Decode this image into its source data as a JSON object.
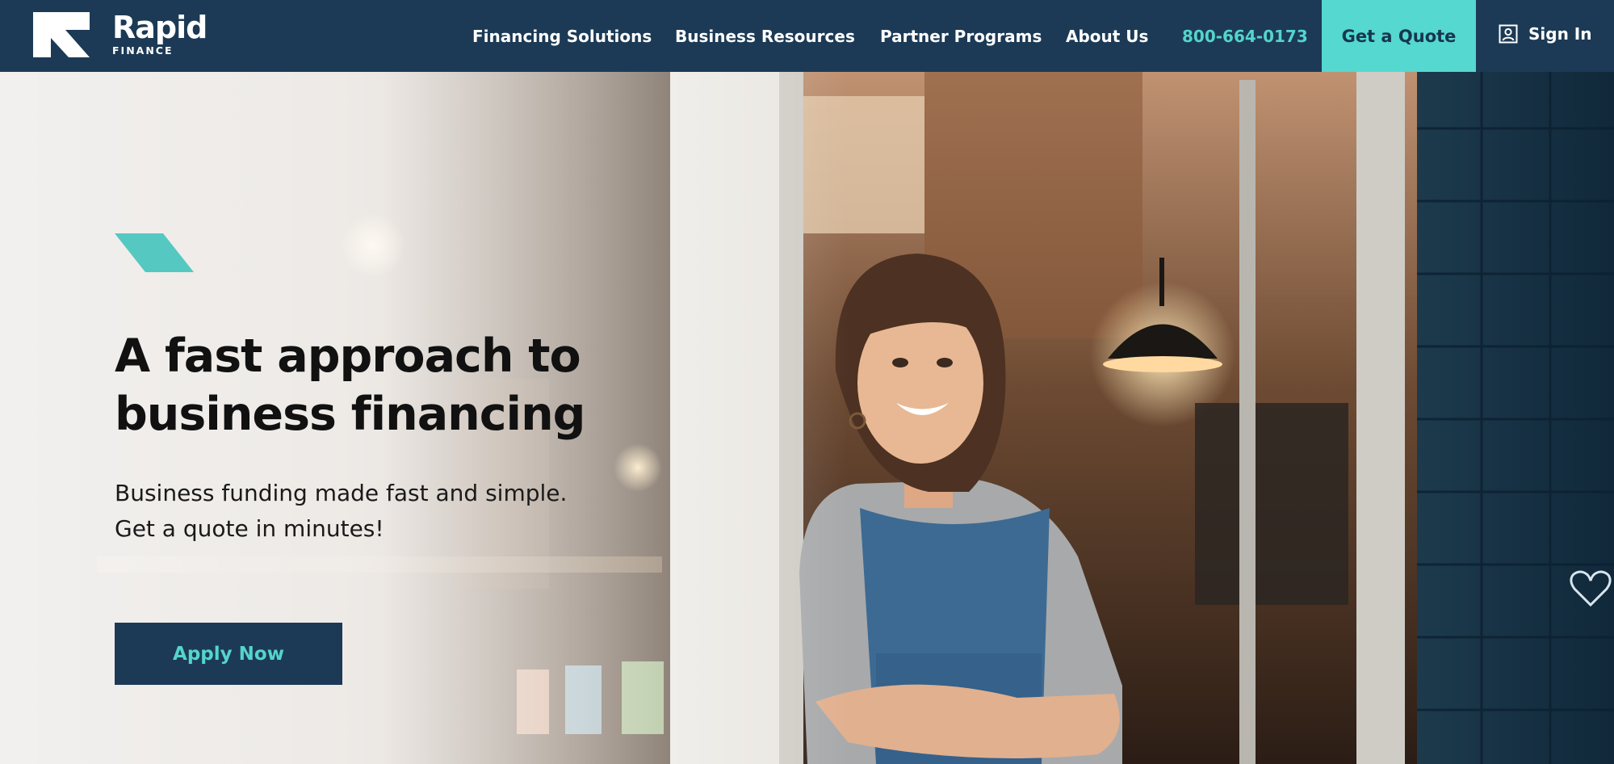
{
  "brand": {
    "name": "Rapid",
    "sub": "FINANCE"
  },
  "nav": {
    "items": [
      {
        "label": "Financing Solutions"
      },
      {
        "label": "Business Resources"
      },
      {
        "label": "Partner Programs"
      },
      {
        "label": "About Us"
      }
    ],
    "phone": "800-664-0173",
    "quote_label": "Get a Quote",
    "signin_label": "Sign In"
  },
  "hero": {
    "headline_line1": "A fast approach to",
    "headline_line2": "business financing",
    "sub_line1": "Business funding made fast and simple.",
    "sub_line2": "Get a quote in minutes!",
    "cta_label": "Apply Now"
  },
  "colors": {
    "nav_bg": "#1c3a55",
    "accent_teal": "#55d8cf",
    "text_dark": "#111111"
  },
  "icons": {
    "logo": "rapid-logo-icon",
    "user": "user-icon",
    "accent": "parallelogram-accent"
  }
}
